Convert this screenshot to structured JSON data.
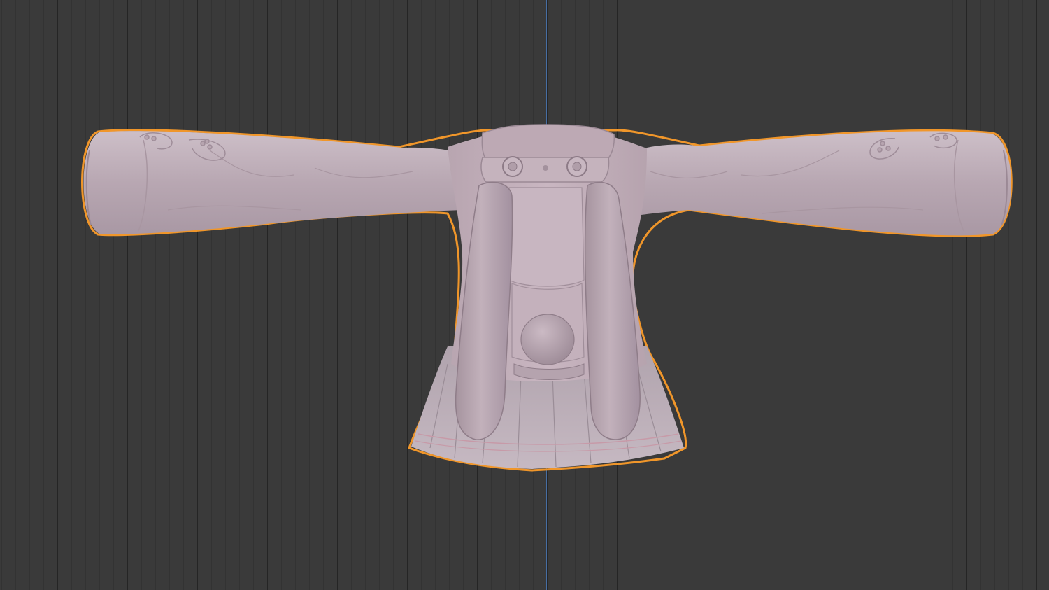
{
  "viewport": {
    "mode": "orthographic-front",
    "grid": true,
    "axis_line_color": "#4a78b6",
    "background_color": "#3a3a3a",
    "selection_outline_color": "#f0962a"
  },
  "model": {
    "description_name": "bunny-jacket-mesh",
    "material_color": "#c4b3bc",
    "selected": true
  }
}
